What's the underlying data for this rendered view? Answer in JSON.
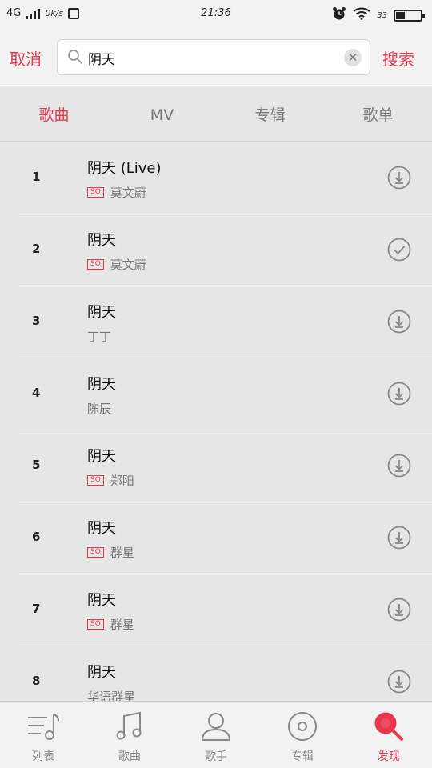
{
  "status_bar": {
    "network": "4G",
    "speed": "0k/s",
    "time": "21:36",
    "battery": "33",
    "battery_level": 0.33
  },
  "header": {
    "cancel_label": "取消",
    "search_value": "阴天",
    "search_label": "搜索"
  },
  "tabs": [
    {
      "label": "歌曲",
      "active": true
    },
    {
      "label": "MV"
    },
    {
      "label": "专辑"
    },
    {
      "label": "歌单"
    }
  ],
  "songs": [
    {
      "index": "1",
      "title": "阴天 (Live)",
      "sq": "SQ",
      "artist": "莫文蔚",
      "action": "download-icon"
    },
    {
      "index": "2",
      "title": "阴天",
      "sq": "SQ",
      "artist": "莫文蔚",
      "action": "check-icon"
    },
    {
      "index": "3",
      "title": "阴天",
      "artist": "丁丁",
      "action": "download-icon"
    },
    {
      "index": "4",
      "title": "阴天",
      "artist": "陈辰",
      "action": "download-icon"
    },
    {
      "index": "5",
      "title": "阴天",
      "sq": "SQ",
      "artist": "郑阳",
      "action": "download-icon"
    },
    {
      "index": "6",
      "title": "阴天",
      "sq": "SQ",
      "artist": "群星",
      "action": "download-icon"
    },
    {
      "index": "7",
      "title": "阴天",
      "sq": "SQ",
      "artist": "群星",
      "action": "download-icon"
    },
    {
      "index": "8",
      "title": "阴天",
      "artist": "华语群星",
      "action": "download-icon"
    }
  ],
  "bottom_nav": [
    {
      "label": "列表",
      "icon": "playlist-icon"
    },
    {
      "label": "歌曲",
      "icon": "music-note-icon"
    },
    {
      "label": "歌手",
      "icon": "person-icon"
    },
    {
      "label": "专辑",
      "icon": "disc-icon"
    },
    {
      "label": "发现",
      "icon": "search-icon",
      "active": true
    }
  ],
  "colors": {
    "accent": "#e8374f",
    "background": "#e6e6e6"
  }
}
